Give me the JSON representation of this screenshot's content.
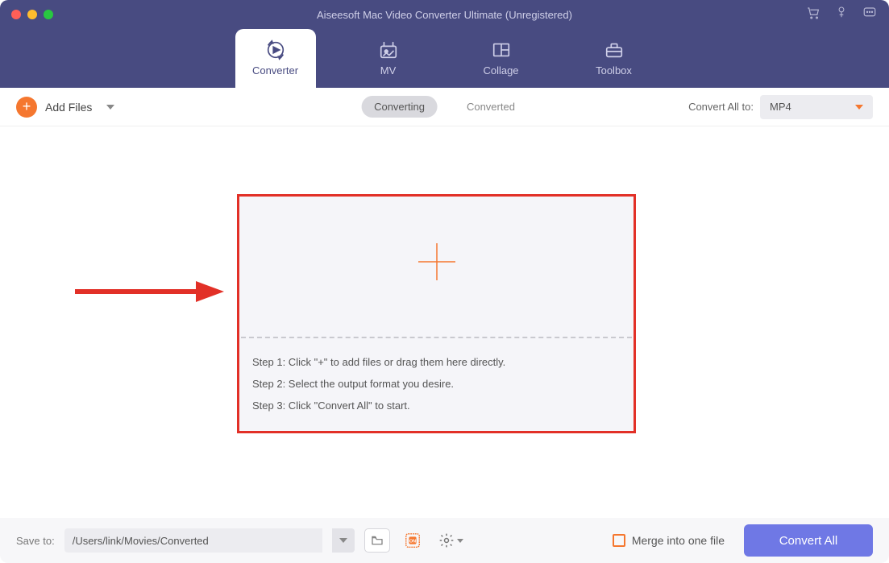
{
  "app_title": "Aiseesoft Mac Video Converter Ultimate (Unregistered)",
  "colors": {
    "header_bg": "#484b81",
    "accent_orange": "#f5772f",
    "primary_blue": "#6f78e5",
    "annotation_red": "#e23027"
  },
  "tabs": {
    "converter": "Converter",
    "mv": "MV",
    "collage": "Collage",
    "toolbox": "Toolbox"
  },
  "toolbar": {
    "add_files_label": "Add Files",
    "converting_label": "Converting",
    "converted_label": "Converted",
    "convert_all_to_label": "Convert All to:",
    "format_selected": "MP4"
  },
  "dropzone": {
    "step1": "Step 1: Click \"+\" to add files or drag them here directly.",
    "step2": "Step 2: Select the output format you desire.",
    "step3": "Step 3: Click \"Convert All\" to start."
  },
  "footer": {
    "save_to_label": "Save to:",
    "save_path": "/Users/link/Movies/Converted",
    "merge_label": "Merge into one file",
    "convert_all_button": "Convert All"
  }
}
